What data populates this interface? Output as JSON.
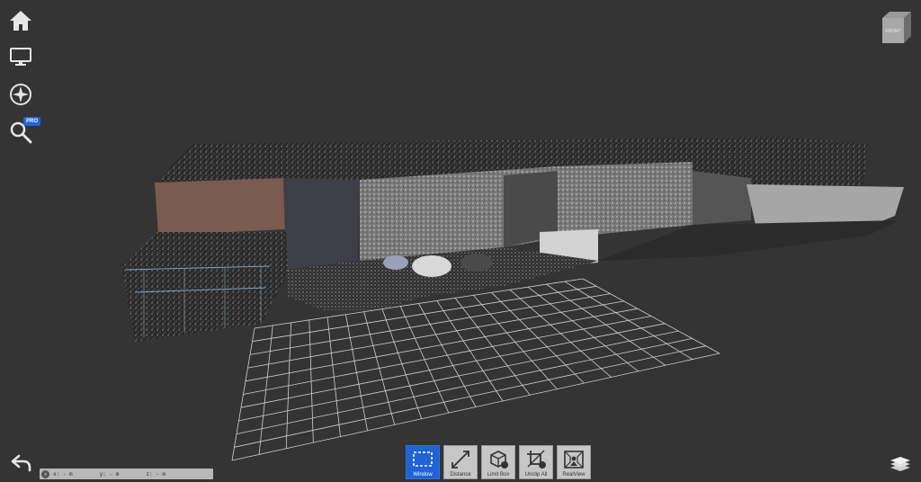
{
  "left_toolbar": {
    "home_title": "Home",
    "views_title": "Views",
    "navigation_title": "Navigation",
    "search_title": "Search",
    "pro_badge": "PRO"
  },
  "view_cube": {
    "face_label": "FRONT"
  },
  "toolbar": {
    "buttons": [
      {
        "label": "Window",
        "icon": "window-select-icon",
        "active": true
      },
      {
        "label": "Distance",
        "icon": "distance-icon",
        "active": false
      },
      {
        "label": "Limit Box",
        "icon": "limit-box-icon",
        "active": false
      },
      {
        "label": "Unclip All",
        "icon": "unclip-icon",
        "active": false
      },
      {
        "label": "RealView",
        "icon": "realview-icon",
        "active": false
      }
    ]
  },
  "coordinates": {
    "x": "x: -  m",
    "y": "y: -  m",
    "z": "z: -  m"
  },
  "colors": {
    "background": "#343434",
    "active_tool": "#1f63d4",
    "tool_button": "#c6c6c6",
    "pro_badge": "#1f66d6"
  }
}
